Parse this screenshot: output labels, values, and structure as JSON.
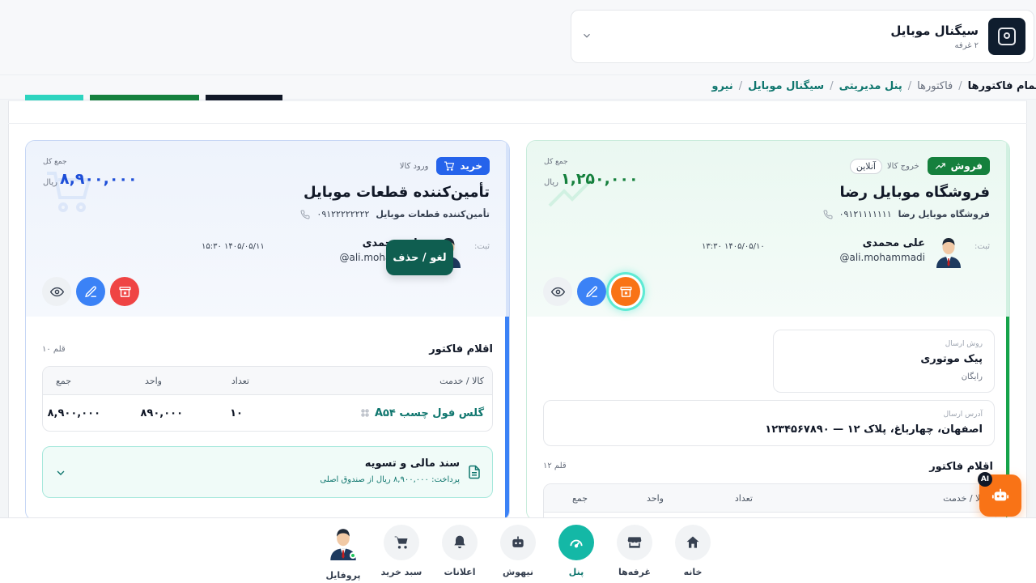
{
  "shop": {
    "name": "سیگنال موبایل",
    "rooms": "۲ غرفه"
  },
  "breadcrumb": [
    {
      "label": "نیرو",
      "type": "link"
    },
    {
      "label": "سیگنال موبایل",
      "type": "link"
    },
    {
      "label": "پنل مدیریتی",
      "type": "link"
    },
    {
      "label": "فاکتورها",
      "type": "muted"
    },
    {
      "label": "تمام فاکتورها",
      "type": "current"
    }
  ],
  "tooltip": "لغو / حذف",
  "sale": {
    "type_label": "فروش",
    "kind": "خروج کالا",
    "channel": "آنلاین",
    "party_name": "فروشگاه موبایل رضا",
    "party_sub": "فروشگاه موبایل رضا",
    "phone": "۰۹۱۲۱۱۱۱۱۱۱",
    "total_label": "جمع کل",
    "total": "۱,۲۵۰,۰۰۰",
    "unit": "ریال",
    "reg_label": "ثبت:",
    "user_name": "علی محمدی",
    "user_mail": "ali.mohammadi@",
    "date": "۱۴۰۵/۰۵/۱۰ ۱۳:۳۰",
    "shipping_label": "روش ارسال",
    "shipping_value": "پیک موتوری",
    "shipping_note": "رایگان",
    "address_label": "آدرس ارسال",
    "address_value": "اصفهان، چهارباغ، پلاک ۱۲ — ۱۲۳۴۵۶۷۸۹۰",
    "items_title": "اقلام فاکتور",
    "items_count": "۱۲ قلم",
    "columns": [
      "کالا / خدمت",
      "تعداد",
      "واحد",
      "جمع"
    ]
  },
  "buy": {
    "type_label": "خرید",
    "kind": "ورود کالا",
    "party_name": "تأمین‌کننده قطعات موبایل",
    "party_sub": "تأمین‌کننده قطعات موبایل",
    "phone": "۰۹۱۲۲۲۲۲۲۲۲",
    "total_label": "جمع کل",
    "total": "۸,۹۰۰,۰۰۰",
    "unit": "ریال",
    "reg_label": "ثبت:",
    "user_name": "علی محمدی",
    "user_mail": "ali.mohammadi@",
    "date": "۱۴۰۵/۰۵/۱۱ ۱۵:۳۰",
    "items_title": "اقلام فاکتور",
    "items_count": "۱۰ قلم",
    "columns": [
      "کالا / خدمت",
      "تعداد",
      "واحد",
      "جمع"
    ],
    "rows": [
      {
        "name": "گلس فول چسب A۵۴",
        "qty": "۱۰",
        "unit_price": "۸۹۰,۰۰۰",
        "sum": "۸,۹۰۰,۰۰۰"
      }
    ],
    "finance_title": "سند مالی و تسویه",
    "finance_sub": "پرداخت: ۸,۹۰۰,۰۰۰ ریال از صندوق اصلی"
  },
  "nav": [
    {
      "label": "خانه",
      "icon": "home-icon"
    },
    {
      "label": "غرفه‌ها",
      "icon": "store-icon"
    },
    {
      "label": "پنل",
      "icon": "dashboard-icon",
      "active": true
    },
    {
      "label": "نیهوش",
      "icon": "robot-icon"
    },
    {
      "label": "اعلانات",
      "icon": "bell-icon"
    },
    {
      "label": "سبد خرید",
      "icon": "cart-icon"
    },
    {
      "label": "پروفایل",
      "icon": "avatar"
    }
  ],
  "ai_badge": "AI",
  "colors": {
    "accent": "#14b8a6",
    "sale": "#15803d",
    "buy": "#2563eb",
    "danger": "#ef4444",
    "warning": "#f97316"
  }
}
